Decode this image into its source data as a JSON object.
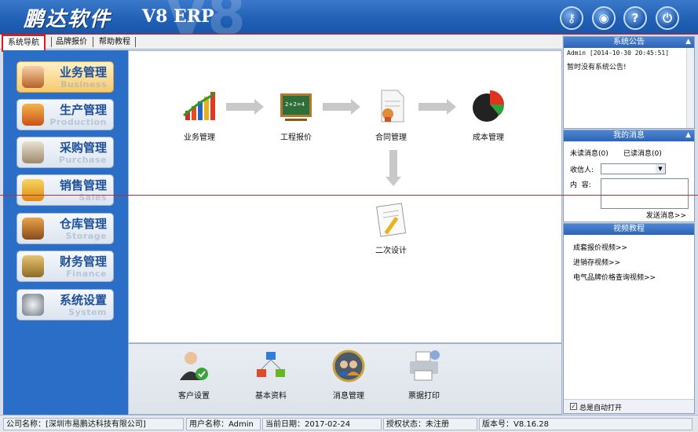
{
  "header": {
    "logo": "鹏达软件",
    "product": "V8 ERP",
    "watermark": "V8",
    "buttons": [
      {
        "icon": "key-icon",
        "glyph": "⚷"
      },
      {
        "icon": "bell-icon",
        "glyph": "◉"
      },
      {
        "icon": "help-icon",
        "glyph": "?"
      },
      {
        "icon": "power-icon",
        "glyph": "⏻"
      }
    ]
  },
  "tabs": [
    "系统导航",
    "品牌报价",
    "帮助教程"
  ],
  "nav": [
    {
      "label": "业务管理",
      "sub": "Business"
    },
    {
      "label": "生产管理",
      "sub": "Production"
    },
    {
      "label": "采购管理",
      "sub": "Purchase"
    },
    {
      "label": "销售管理",
      "sub": "Sales"
    },
    {
      "label": "仓库管理",
      "sub": "Storage"
    },
    {
      "label": "财务管理",
      "sub": "Finance"
    },
    {
      "label": "系统设置",
      "sub": "System"
    }
  ],
  "flow": {
    "business": "业务管理",
    "quote": "工程报价",
    "contract": "合同管理",
    "cost": "成本管理",
    "redesign": "二次设计"
  },
  "tools": [
    "客户设置",
    "基本资料",
    "消息管理",
    "票据打印"
  ],
  "notice": {
    "title": "系统公告",
    "meta": "Admin [2014-10-30 20:45:51]",
    "text": "暂时没有系统公告!"
  },
  "messages": {
    "title": "我的消息",
    "unread": "未读消息(0)",
    "read": "已读消息(0)",
    "recipient_label": "收信人:",
    "content_label": "内  容:",
    "send": "发送消息>>"
  },
  "videos": {
    "title": "视频教程",
    "links": [
      "成套报价视频>>",
      "进销存视频>>",
      "电气品牌价格查询视频>>"
    ],
    "autoopen": "总是自动打开"
  },
  "status": {
    "company": "公司名称：[深圳市易鹏达科技有限公司]",
    "user": "用户名称：Admin",
    "date": "当前日期：2017-02-24",
    "auth": "授权状态：未注册",
    "version": "版本号：V8.16.28"
  }
}
